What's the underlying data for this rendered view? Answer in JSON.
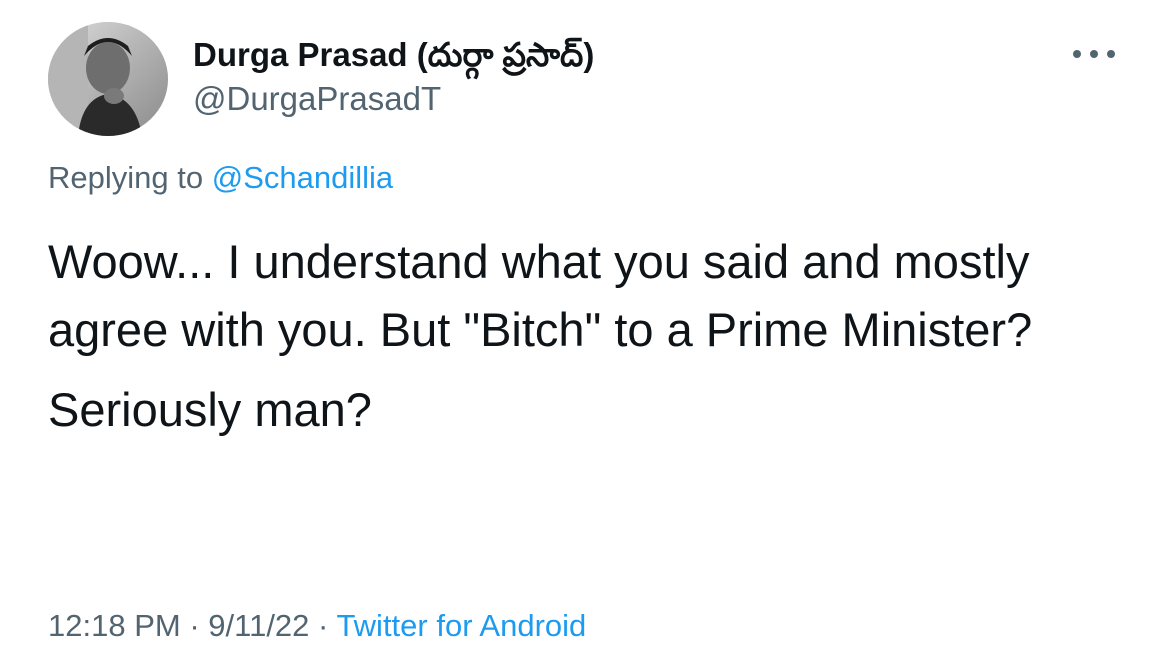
{
  "author": {
    "display_name": "Durga Prasad (దుర్గా ప్రసాద్)",
    "handle": "@DurgaPrasadT"
  },
  "reply": {
    "prefix": "Replying to",
    "mention": "@Schandillia"
  },
  "tweet": {
    "paragraph_1": "Woow... I understand what you said and mostly agree with you. But \"Bitch\" to a Prime Minister?",
    "paragraph_2": "Seriously man?"
  },
  "meta": {
    "time": "12:18 PM",
    "separator": "·",
    "date": "9/11/22",
    "source": "Twitter for Android"
  },
  "icons": {
    "more": "more-horizontal-icon"
  },
  "colors": {
    "link": "#1d9bf0",
    "secondary_text": "#536471",
    "primary_text": "#0f1419"
  }
}
